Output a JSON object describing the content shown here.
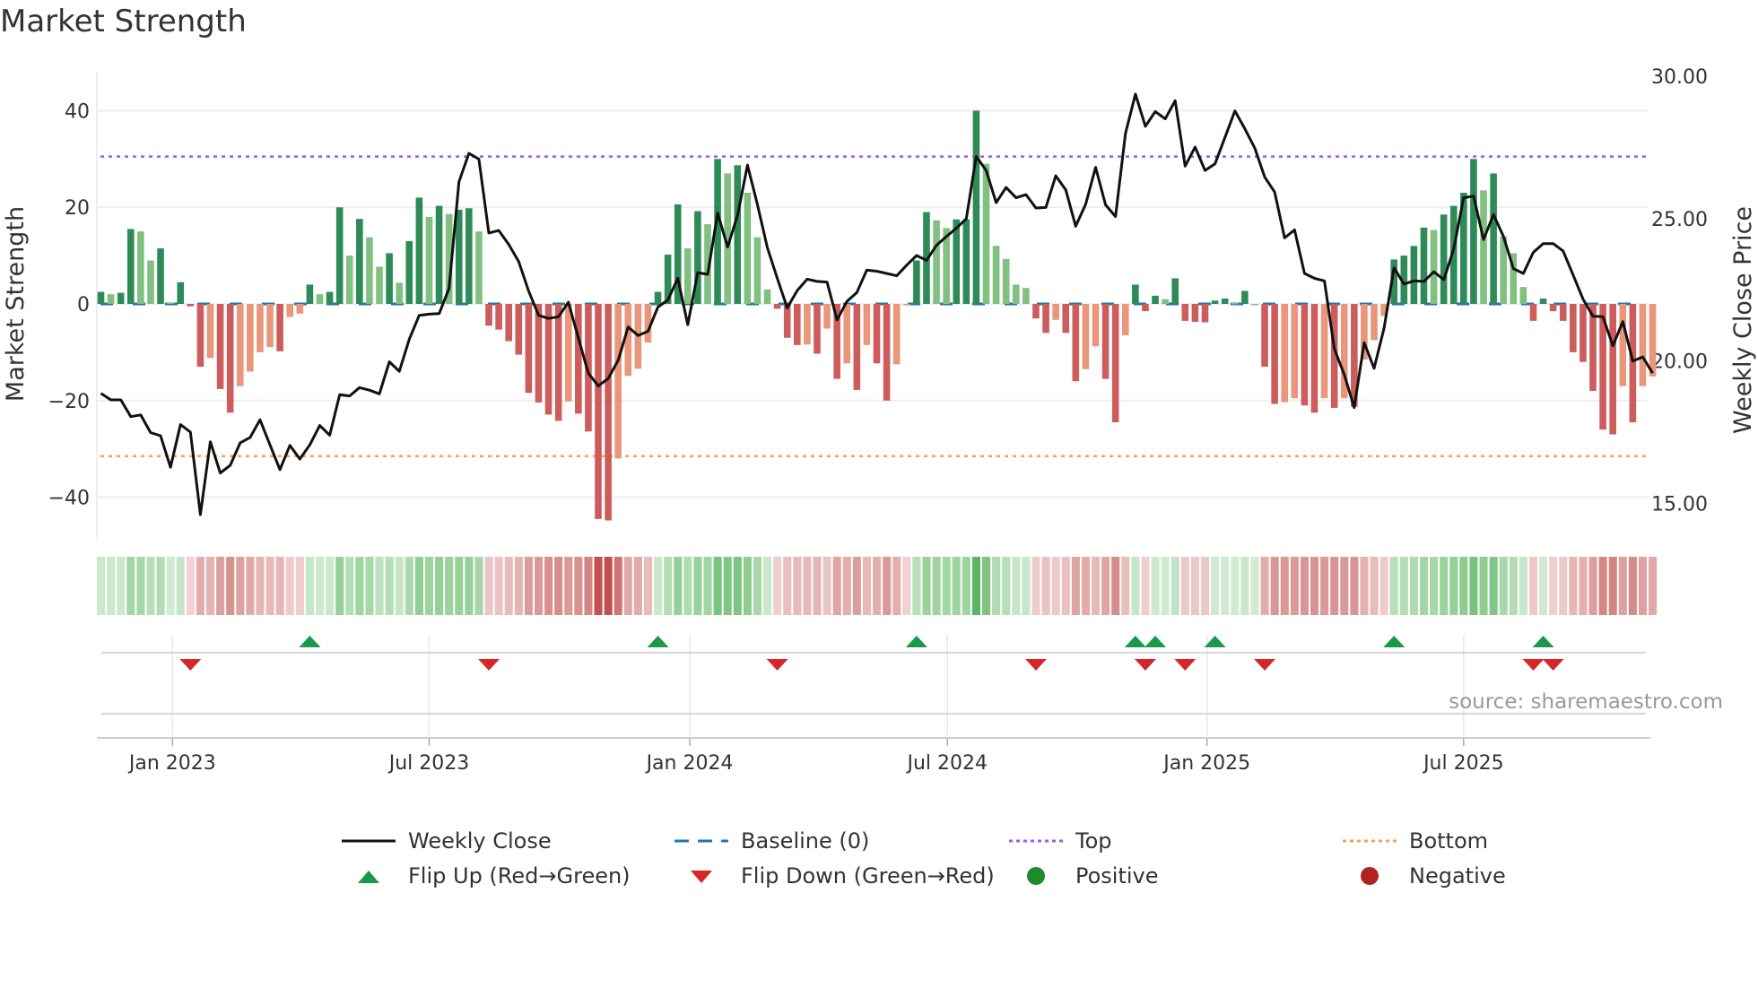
{
  "title": "Market Strength",
  "source_note": "source: sharemaestro.com",
  "chart_data": {
    "type": "bar",
    "title": "Market Strength",
    "ylabel": "Market Strength",
    "y2label": "Weekly Close Price",
    "ylim": [
      -48,
      50
    ],
    "y2lim": [
      13.4,
      30.6
    ],
    "yticks": [
      {
        "value": 40,
        "label": "40"
      },
      {
        "value": 20,
        "label": "20"
      },
      {
        "value": 0,
        "label": "0"
      },
      {
        "value": -20,
        "label": "−20"
      },
      {
        "value": -40,
        "label": "−40"
      }
    ],
    "y2ticks": [
      {
        "value": 30,
        "label": "30.00"
      },
      {
        "value": 25,
        "label": "25.00"
      },
      {
        "value": 20,
        "label": "20.00"
      },
      {
        "value": 15,
        "label": "15.00"
      }
    ],
    "xticks": [
      {
        "week": 7.2,
        "label": "Jan 2023"
      },
      {
        "week": 33.0,
        "label": "Jul 2023"
      },
      {
        "week": 59.2,
        "label": "Jan 2024"
      },
      {
        "week": 85.1,
        "label": "Jul 2024"
      },
      {
        "week": 111.2,
        "label": "Jan 2025"
      },
      {
        "week": 137.0,
        "label": "Jul 2025"
      }
    ],
    "top_level": 30.5,
    "bottom_level": -31.5,
    "baseline": 0,
    "strength": [
      2.5,
      2,
      2.3,
      15.5,
      15,
      9,
      11.5,
      0.3,
      4.5,
      -0.5,
      -13,
      -11.2,
      -17.6,
      -22.5,
      -17,
      -14,
      -10,
      -8.9,
      -9.8,
      -2.7,
      -2,
      4,
      2,
      2.5,
      20,
      10,
      17.6,
      13.8,
      7.7,
      10.5,
      4.4,
      13,
      22,
      18,
      20.3,
      18.6,
      19.5,
      19.8,
      15,
      -4.5,
      -5.3,
      -7.7,
      -10.5,
      -18.4,
      -20.4,
      -22.9,
      -24.2,
      -20.2,
      -22.7,
      -26.4,
      -44.5,
      -44.8,
      -32,
      -14.9,
      -13.4,
      -8,
      2.5,
      10.2,
      20.6,
      11.5,
      19.2,
      16.5,
      30,
      27,
      28.7,
      23,
      13.8,
      3,
      -1,
      -7,
      -8.5,
      -8.4,
      -10.3,
      -5.1,
      -15.5,
      -12.3,
      -17.8,
      -8.5,
      -12.3,
      -20,
      -12.5,
      -0.3,
      9,
      19,
      17.3,
      15.7,
      17.5,
      17.5,
      40,
      29,
      12,
      9.3,
      4,
      3.3,
      -3,
      -6,
      -3.3,
      -6,
      -16,
      -13.5,
      -8.8,
      -15.5,
      -24.5,
      -6.5,
      4,
      -1.5,
      1.7,
      1,
      5.3,
      -3.5,
      -3.7,
      -3.8,
      0.7,
      1.1,
      0.2,
      2.7,
      0,
      -13,
      -20.7,
      -20.3,
      -19.5,
      -21,
      -22.5,
      -19.5,
      -21.5,
      -19.5,
      -21.3,
      -11.5,
      -7.5,
      -2.5,
      9.2,
      10,
      12,
      15.8,
      15.3,
      18.5,
      20.3,
      23,
      30,
      23.5,
      27,
      14,
      10.5,
      3.5,
      -3.5,
      1.1,
      -1.5,
      -3.5,
      -10,
      -12,
      -18,
      -26,
      -27,
      -17,
      -24.5,
      -17,
      -15
    ],
    "weekly_close": [
      18.86,
      18.63,
      18.63,
      18.04,
      18.1,
      17.48,
      17.37,
      16.26,
      17.76,
      17.5,
      14.6,
      17.16,
      16.06,
      16.33,
      17.12,
      17.31,
      17.93,
      17.05,
      16.18,
      17.03,
      16.55,
      17.05,
      17.73,
      17.39,
      18.81,
      18.77,
      19.06,
      18.97,
      18.84,
      19.97,
      19.63,
      20.76,
      21.6,
      21.64,
      21.66,
      22.54,
      26.29,
      27.29,
      27.09,
      24.49,
      24.58,
      24.09,
      23.49,
      22.45,
      21.6,
      21.49,
      21.55,
      22.06,
      20.81,
      19.57,
      19.12,
      19.38,
      20.02,
      21.19,
      20.89,
      21.04,
      21.89,
      22.14,
      22.9,
      21.27,
      23.1,
      23.04,
      25.19,
      24.0,
      25.11,
      26.88,
      25.5,
      23.98,
      22.9,
      21.86,
      22.47,
      22.87,
      22.79,
      22.77,
      21.44,
      22.09,
      22.4,
      23.19,
      23.15,
      23.07,
      22.99,
      23.36,
      23.7,
      23.53,
      24.06,
      24.37,
      24.66,
      24.99,
      27.18,
      26.69,
      25.56,
      26.09,
      25.73,
      25.84,
      25.37,
      25.39,
      26.5,
      26.01,
      24.73,
      25.5,
      26.8,
      25.48,
      25.07,
      27.99,
      29.37,
      28.24,
      28.76,
      28.5,
      29.14,
      26.84,
      27.51,
      26.69,
      26.92,
      27.85,
      28.78,
      28.16,
      27.48,
      26.46,
      25.93,
      24.32,
      24.6,
      23.07,
      22.9,
      22.81,
      20.42,
      19.51,
      18.36,
      20.64,
      19.74,
      21.15,
      23.27,
      22.7,
      22.81,
      22.79,
      23.13,
      22.85,
      23.92,
      25.73,
      25.79,
      24.26,
      25.14,
      24.37,
      23.24,
      23.07,
      23.81,
      24.12,
      24.12,
      23.86,
      23.02,
      22.17,
      21.57,
      21.55,
      20.53,
      21.38,
      19.99,
      20.14,
      19.57
    ],
    "legend": [
      {
        "key": "weekly_close",
        "label": "Weekly Close"
      },
      {
        "key": "baseline",
        "label": "Baseline (0)"
      },
      {
        "key": "top",
        "label": "Top"
      },
      {
        "key": "bottom",
        "label": "Bottom"
      },
      {
        "key": "flip_up",
        "label": "Flip Up (Red→Green)"
      },
      {
        "key": "flip_down",
        "label": "Flip Down (Green→Red)"
      },
      {
        "key": "positive",
        "label": "Positive"
      },
      {
        "key": "negative",
        "label": "Negative"
      }
    ],
    "legend_placement": "bottom",
    "grid": true
  },
  "colors": {
    "green_strong": "#2e8b57",
    "green_weak": "#80c080",
    "red_strong": "#cd5c5c",
    "red_weak": "#e9967a",
    "line": "#111111",
    "baseline": "#1f77b4",
    "top": "#9b5de5",
    "bottom": "#f4a259",
    "flip_up": "#1a9a48",
    "flip_down": "#d62728",
    "positive": "#1f8b2c",
    "negative": "#b22222"
  }
}
